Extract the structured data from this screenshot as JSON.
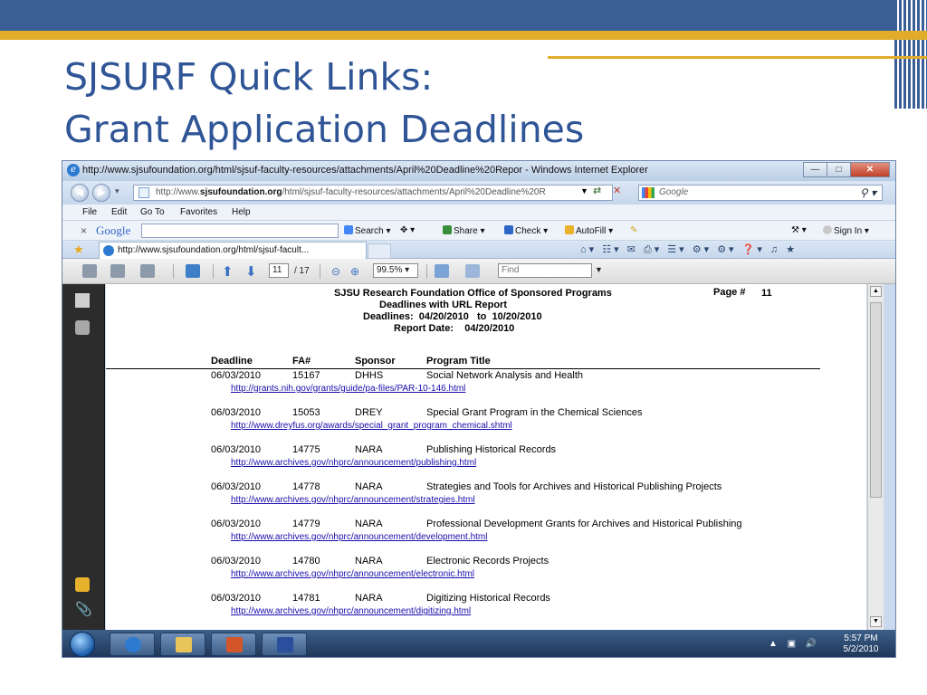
{
  "slide": {
    "title_line1": "SJSURF Quick Links:",
    "title_line2": "Grant Application Deadlines"
  },
  "colors": {
    "slide_blue": "#3a5f97",
    "slide_gold": "#e0ac2a",
    "title_blue": "#2f5596",
    "link_blue": "#1a0dab"
  },
  "browser": {
    "window_title": "http://www.sjsufoundation.org/html/sjsuf-faculty-resources/attachments/April%20Deadline%20Repor - Windows Internet Explorer",
    "address_prefix": "http://www.",
    "address_domain": "sjsufoundation.org",
    "address_rest": "/html/sjsuf-faculty-resources/attachments/April%20Deadline%20R",
    "search_placeholder": "Google",
    "menu": [
      "File",
      "Edit",
      "Go To",
      "Favorites",
      "Help"
    ],
    "google_toolbar": {
      "logo": "Google",
      "search": "Search",
      "share": "Share",
      "check": "Check",
      "autofill": "AutoFill",
      "sign_in": "Sign In"
    },
    "tab_title": "http://www.sjsufoundation.org/html/sjsuf-facult...",
    "icons": [
      "ie-icon",
      "back-icon",
      "forward-icon",
      "refresh-icon",
      "stop-icon",
      "favorites-star-icon",
      "home-icon",
      "print-icon"
    ]
  },
  "pdf_toolbar": {
    "page_current": "11",
    "page_total": "/ 17",
    "zoom": "99.5%",
    "find_placeholder": "Find"
  },
  "report": {
    "title": "SJSU Research Foundation Office of Sponsored Programs",
    "subtitle": "Deadlines with URL Report",
    "deadlines_label": "Deadlines:",
    "deadlines_from": "04/20/2010",
    "deadlines_to_word": "to",
    "deadlines_to": "10/20/2010",
    "report_date_label": "Report Date:",
    "report_date": "04/20/2010",
    "page_label": "Page #",
    "page_number": "11",
    "columns": [
      "Deadline",
      "FA#",
      "Sponsor",
      "Program Title"
    ],
    "rows": [
      {
        "deadline": "06/03/2010",
        "fa": "15167",
        "sponsor": "DHHS",
        "title": "Social Network Analysis and Health",
        "url": "http://grants.nih.gov/grants/guide/pa-files/PAR-10-146.html"
      },
      {
        "deadline": "06/03/2010",
        "fa": "15053",
        "sponsor": "DREY",
        "title": "Special Grant Program in the Chemical Sciences",
        "url": "http://www.dreyfus.org/awards/special_grant_program_chemical.shtml"
      },
      {
        "deadline": "06/03/2010",
        "fa": "14775",
        "sponsor": "NARA",
        "title": "Publishing Historical Records",
        "url": "http://www.archives.gov/nhprc/announcement/publishing.html"
      },
      {
        "deadline": "06/03/2010",
        "fa": "14778",
        "sponsor": "NARA",
        "title": "Strategies and Tools for Archives and Historical Publishing Projects",
        "url": "http://www.archives.gov/nhprc/announcement/strategies.html"
      },
      {
        "deadline": "06/03/2010",
        "fa": "14779",
        "sponsor": "NARA",
        "title": "Professional Development Grants for Archives and Historical Publishing",
        "url": "http://www.archives.gov/nhprc/announcement/development.html"
      },
      {
        "deadline": "06/03/2010",
        "fa": "14780",
        "sponsor": "NARA",
        "title": "Electronic Records Projects",
        "url": "http://www.archives.gov/nhprc/announcement/electronic.html"
      },
      {
        "deadline": "06/03/2010",
        "fa": "14781",
        "sponsor": "NARA",
        "title": "Digitizing Historical Records",
        "url": "http://www.archives.gov/nhprc/announcement/digitizing.html"
      }
    ]
  },
  "taskbar": {
    "time": "5:57 PM",
    "date": "5/2/2010"
  }
}
